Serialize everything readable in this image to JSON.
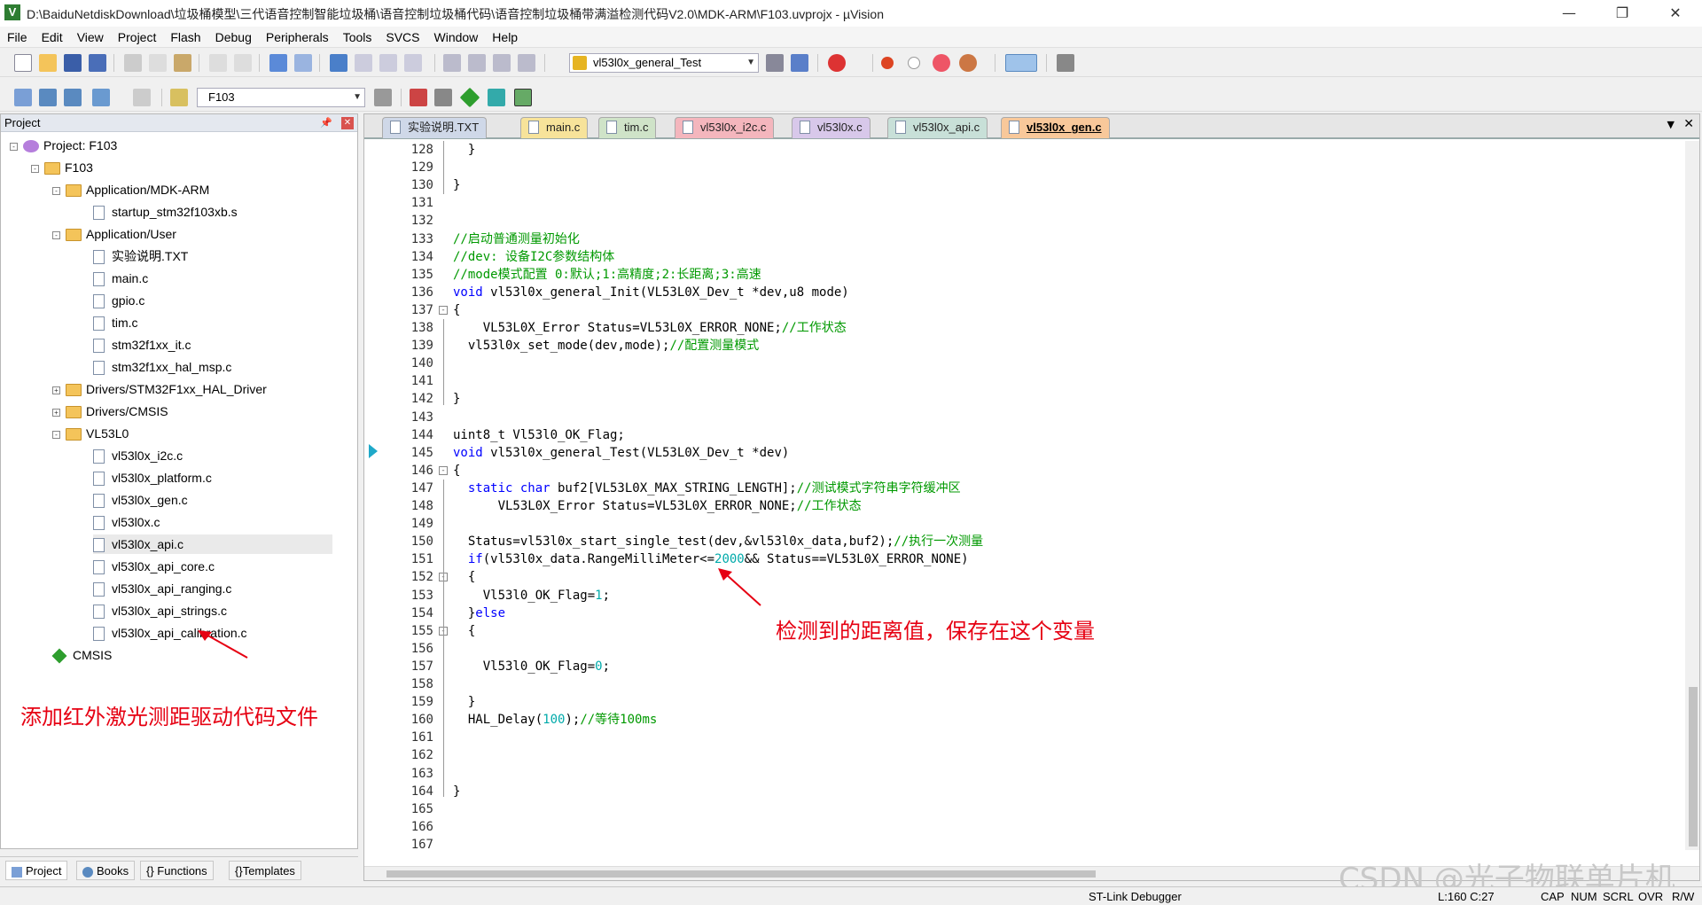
{
  "window": {
    "title": "D:\\BaiduNetdiskDownload\\垃圾桶模型\\三代语音控制智能垃圾桶\\语音控制垃圾桶代码\\语音控制垃圾桶带满溢检测代码V2.0\\MDK-ARM\\F103.uvprojx - µVision"
  },
  "menu": [
    "File",
    "Edit",
    "View",
    "Project",
    "Flash",
    "Debug",
    "Peripherals",
    "Tools",
    "SVCS",
    "Window",
    "Help"
  ],
  "toolbar1": {
    "function_combo": "vl53l0x_general_Test"
  },
  "toolbar2": {
    "target_combo": "F103"
  },
  "project": {
    "header": "Project",
    "tree": [
      {
        "label": "Project: F103",
        "level": 0,
        "type": "gear",
        "exp": "-"
      },
      {
        "label": "F103",
        "level": 1,
        "type": "folder",
        "exp": "-"
      },
      {
        "label": "Application/MDK-ARM",
        "level": 2,
        "type": "folder",
        "exp": "-"
      },
      {
        "label": "startup_stm32f103xb.s",
        "level": 3,
        "type": "file"
      },
      {
        "label": "Application/User",
        "level": 2,
        "type": "folder",
        "exp": "-"
      },
      {
        "label": "实验说明.TXT",
        "level": 3,
        "type": "file"
      },
      {
        "label": "main.c",
        "level": 3,
        "type": "file"
      },
      {
        "label": "gpio.c",
        "level": 3,
        "type": "file"
      },
      {
        "label": "tim.c",
        "level": 3,
        "type": "file"
      },
      {
        "label": "stm32f1xx_it.c",
        "level": 3,
        "type": "file"
      },
      {
        "label": "stm32f1xx_hal_msp.c",
        "level": 3,
        "type": "file"
      },
      {
        "label": "Drivers/STM32F1xx_HAL_Driver",
        "level": 2,
        "type": "folder",
        "exp": "+"
      },
      {
        "label": "Drivers/CMSIS",
        "level": 2,
        "type": "folder",
        "exp": "+"
      },
      {
        "label": "VL53L0",
        "level": 2,
        "type": "folder",
        "exp": "-"
      },
      {
        "label": "vl53l0x_i2c.c",
        "level": 3,
        "type": "file"
      },
      {
        "label": "vl53l0x_platform.c",
        "level": 3,
        "type": "file"
      },
      {
        "label": "vl53l0x_gen.c",
        "level": 3,
        "type": "file"
      },
      {
        "label": "vl53l0x.c",
        "level": 3,
        "type": "file"
      },
      {
        "label": "vl53l0x_api.c",
        "level": 3,
        "type": "file"
      },
      {
        "label": "vl53l0x_api_core.c",
        "level": 3,
        "type": "file"
      },
      {
        "label": "vl53l0x_api_ranging.c",
        "level": 3,
        "type": "file"
      },
      {
        "label": "vl53l0x_api_strings.c",
        "level": 3,
        "type": "file"
      },
      {
        "label": "vl53l0x_api_calibration.c",
        "level": 3,
        "type": "file"
      },
      {
        "label": "CMSIS",
        "level": 2,
        "type": "diamond"
      }
    ],
    "annotation": "添加红外激光测距驱动代码文件"
  },
  "bottom_tabs": [
    "Project",
    "Books",
    "Functions",
    "Templates"
  ],
  "editor": {
    "tabs": [
      {
        "label": "实验说明.TXT",
        "color": "#cfd8e8"
      },
      {
        "label": "main.c",
        "color": "#f7e39a"
      },
      {
        "label": "tim.c",
        "color": "#cfe3c8"
      },
      {
        "label": "vl53l0x_i2c.c",
        "color": "#f4b6bd"
      },
      {
        "label": "vl53l0x.c",
        "color": "#d8c8ea"
      },
      {
        "label": "vl53l0x_api.c",
        "color": "#c8e0d8"
      },
      {
        "label": "vl53l0x_gen.c",
        "color": "#f8c89a"
      }
    ],
    "lines": [
      {
        "n": "128",
        "html": "  }"
      },
      {
        "n": "129",
        "html": ""
      },
      {
        "n": "130",
        "html": "}"
      },
      {
        "n": "131",
        "html": ""
      },
      {
        "n": "132",
        "html": ""
      },
      {
        "n": "133",
        "html": "<span class=\"cm\">//启动普通测量初始化</span>"
      },
      {
        "n": "134",
        "html": "<span class=\"cm\">//dev: 设备I2C参数结构体</span>"
      },
      {
        "n": "135",
        "html": "<span class=\"cm\">//mode模式配置 0:默认;1:高精度;2:长距离;3:高速</span>"
      },
      {
        "n": "136",
        "html": "<span class=\"kw\">void</span> vl53l0x_general_Init(VL53L0X_Dev_t *dev,u8 mode)"
      },
      {
        "n": "137",
        "html": "{"
      },
      {
        "n": "138",
        "html": "    VL53L0X_Error Status=VL53L0X_ERROR_NONE;<span class=\"cm\">//工作状态</span>"
      },
      {
        "n": "139",
        "html": "  vl53l0x_set_mode(dev,mode);<span class=\"cm\">//配置测量模式</span>"
      },
      {
        "n": "140",
        "html": ""
      },
      {
        "n": "141",
        "html": ""
      },
      {
        "n": "142",
        "html": "}"
      },
      {
        "n": "143",
        "html": ""
      },
      {
        "n": "144",
        "html": "uint8_t Vl53l0_OK_Flag;"
      },
      {
        "n": "145",
        "html": "<span class=\"kw\">void</span> vl53l0x_general_Test(VL53L0X_Dev_t *dev)"
      },
      {
        "n": "146",
        "html": "{"
      },
      {
        "n": "147",
        "html": "  <span class=\"kw\">static char</span> buf2[VL53L0X_MAX_STRING_LENGTH];<span class=\"cm\">//测试模式字符串字符缓冲区</span>"
      },
      {
        "n": "148",
        "html": "      VL53L0X_Error Status=VL53L0X_ERROR_NONE;<span class=\"cm\">//工作状态</span>"
      },
      {
        "n": "149",
        "html": ""
      },
      {
        "n": "150",
        "html": "  Status=vl53l0x_start_single_test(dev,&amp;vl53l0x_data,buf2);<span class=\"cm\">//执行一次测量</span>"
      },
      {
        "n": "151",
        "html": "  <span class=\"kw\">if</span>(vl53l0x_data.RangeMilliMeter&lt;=<span class=\"num\">2000</span>&amp;&amp; Status==VL53L0X_ERROR_NONE)"
      },
      {
        "n": "152",
        "html": "  {"
      },
      {
        "n": "153",
        "html": "    Vl53l0_OK_Flag=<span class=\"num\">1</span>;"
      },
      {
        "n": "154",
        "html": "  }<span class=\"kw\">else</span>"
      },
      {
        "n": "155",
        "html": "  {"
      },
      {
        "n": "156",
        "html": ""
      },
      {
        "n": "157",
        "html": "    Vl53l0_OK_Flag=<span class=\"num\">0</span>;"
      },
      {
        "n": "158",
        "html": ""
      },
      {
        "n": "159",
        "html": "  }"
      },
      {
        "n": "160",
        "html": "  HAL_Delay(<span class=\"num\">100</span>);<span class=\"cm\">//等待100ms</span>"
      },
      {
        "n": "161",
        "html": ""
      },
      {
        "n": "162",
        "html": ""
      },
      {
        "n": "163",
        "html": ""
      },
      {
        "n": "164",
        "html": "}"
      },
      {
        "n": "165",
        "html": ""
      },
      {
        "n": "166",
        "html": ""
      },
      {
        "n": "167",
        "html": ""
      }
    ],
    "annotation": "检测到的距离值，保存在这个变量"
  },
  "status": {
    "debugger": "ST-Link Debugger",
    "position": "L:160 C:27",
    "indicators": [
      "CAP",
      "NUM",
      "SCRL",
      "OVR",
      "R/W"
    ]
  },
  "watermark": "CSDN @光子物联单片机"
}
